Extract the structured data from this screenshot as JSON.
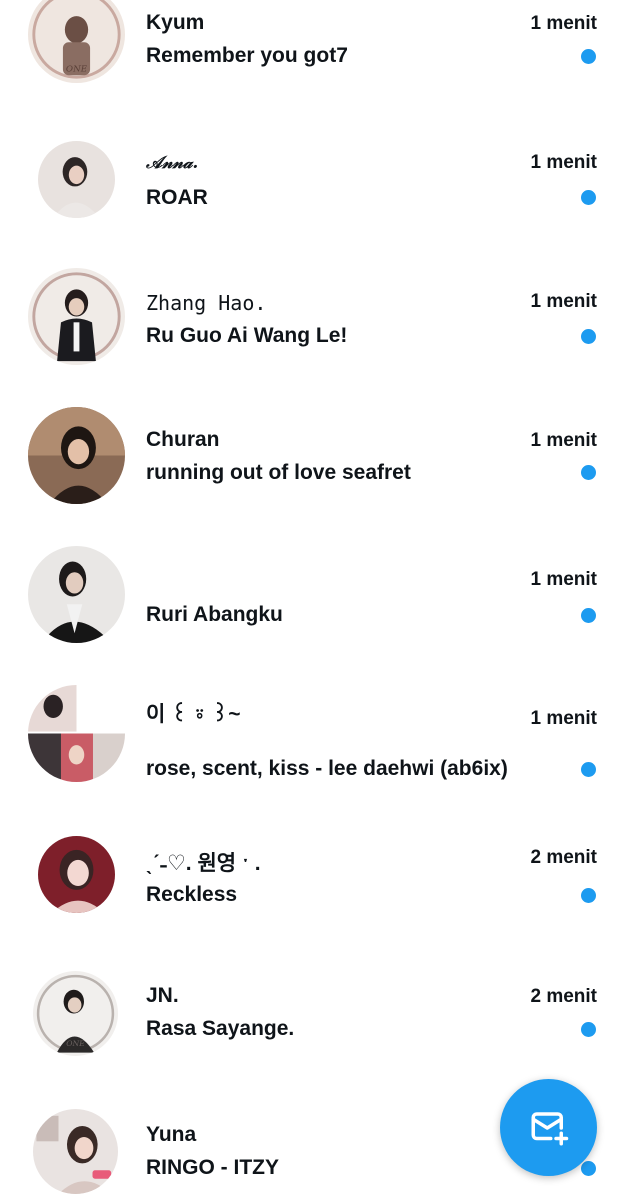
{
  "accent_color": "#1d9bf0",
  "conversations": [
    {
      "name": "Kyum",
      "time": "1 menit",
      "message": "Remember you got7",
      "unread": true,
      "avatar": "avatar-photo"
    },
    {
      "name": "𝒜𝓃𝓃𝒶.",
      "time": "1 menit",
      "message": "ROAR",
      "unread": true,
      "avatar": "avatar-photo"
    },
    {
      "name": "Zhang Hao.",
      "time": "1 menit",
      "message": "Ru Guo Ai Wang Le!",
      "unread": true,
      "avatar": "avatar-photo"
    },
    {
      "name": "Churan",
      "time": "1 menit",
      "message": "running out of love seafret",
      "unread": true,
      "avatar": "avatar-photo"
    },
    {
      "name": "",
      "time": "1 menit",
      "message": "Ruri Abangku",
      "unread": true,
      "avatar": "avatar-photo"
    },
    {
      "name": "이 ꒰ ⍤ ꒱~",
      "time": "1 menit",
      "message": "rose, scent, kiss - lee daehwi (ab6ix)",
      "unread": true,
      "avatar": "avatar-collage"
    },
    {
      "name": "ˎˊ˗♡. 원영 ˑ .",
      "time": "2 menit",
      "message": "Reckless",
      "unread": true,
      "avatar": "avatar-photo"
    },
    {
      "name": "JN.",
      "time": "2 menit",
      "message": "Rasa Sayange.",
      "unread": true,
      "avatar": "avatar-photo"
    },
    {
      "name": "Yuna",
      "time": "",
      "message": "RINGO - ITZY",
      "unread": true,
      "avatar": "avatar-photo"
    }
  ],
  "fab": {
    "icon": "new-message-icon"
  }
}
